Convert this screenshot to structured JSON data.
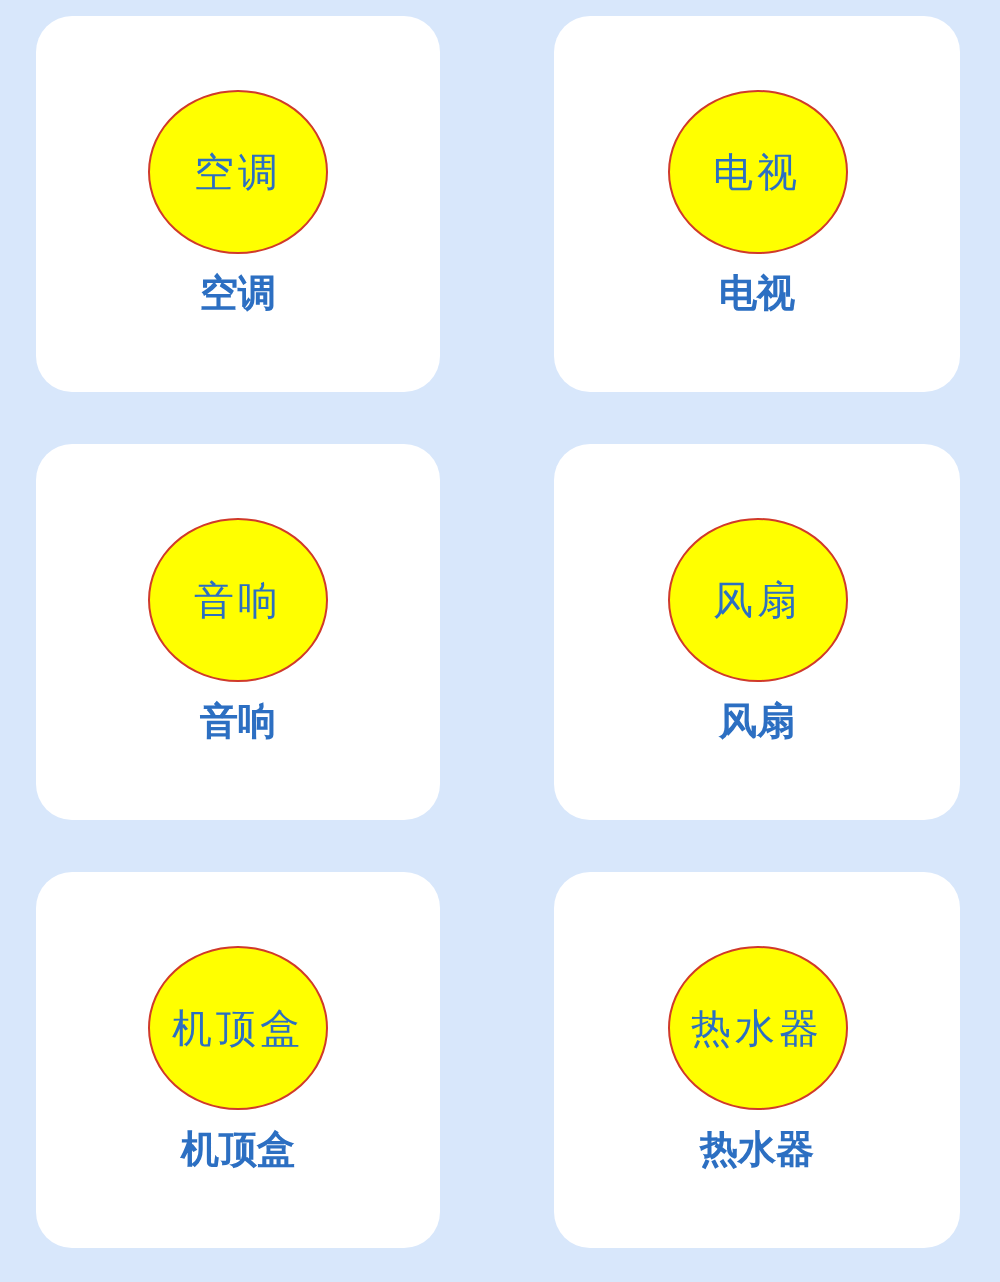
{
  "devices": [
    {
      "badge": "空调",
      "label": "空调"
    },
    {
      "badge": "电视",
      "label": "电视"
    },
    {
      "badge": "音响",
      "label": "音响"
    },
    {
      "badge": "风扇",
      "label": "风扇"
    },
    {
      "badge": "机顶盒",
      "label": "机顶盒"
    },
    {
      "badge": "热水器",
      "label": "热水器"
    }
  ]
}
